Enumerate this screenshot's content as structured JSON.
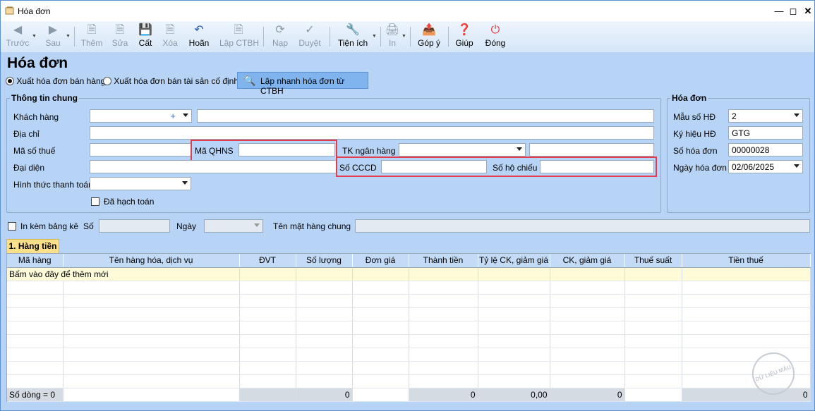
{
  "window": {
    "title": "Hóa đơn"
  },
  "toolbar": {
    "prev": "Trước",
    "next": "Sau",
    "add": "Thêm",
    "edit": "Sửa",
    "save": "Cất",
    "delete": "Xóa",
    "undo": "Hoãn",
    "create_ctbh": "Lập CTBH",
    "reload": "Nạp",
    "approve": "Duyệt",
    "utilities": "Tiện ích",
    "print": "In",
    "feedback": "Góp ý",
    "help": "Giúp",
    "close": "Đóng"
  },
  "page": {
    "title": "Hóa đơn",
    "radio_sales": "Xuất hóa đơn bán hàng",
    "radio_assets": "Xuất hóa đơn bán tài sản cố định",
    "quick_button": "Lập nhanh hóa đơn từ CTBH"
  },
  "general": {
    "title": "Thông tin chung",
    "customer_label": "Khách hàng",
    "address_label": "Địa chỉ",
    "tax_code_label": "Mã số thuế",
    "qhns_label": "Mã QHNS",
    "bank_label": "TK ngân hàng",
    "representative_label": "Đại diện",
    "cccd_label": "Số CCCD",
    "passport_label": "Số hộ chiếu",
    "payment_label": "Hình thức thanh toán",
    "posted_label": "Đã hạch toán"
  },
  "invoice": {
    "title": "Hóa đơn",
    "template_label": "Mẫu số HĐ",
    "template_value": "2",
    "symbol_label": "Ký hiệu HĐ",
    "symbol_value": "GTG",
    "number_label": "Số hóa đơn",
    "number_value": "00000028",
    "date_label": "Ngày hóa đơn",
    "date_value": "02/06/2025"
  },
  "attach": {
    "print_with_list": "In kèm bảng kê",
    "number_label": "Số",
    "date_label": "Ngày",
    "common_item_label": "Tên mặt hàng chung"
  },
  "tab": {
    "label": "1. Hàng tiền"
  },
  "grid": {
    "columns": [
      "Mã hàng",
      "Tên hàng hóa, dịch vụ",
      "ĐVT",
      "Số lượng",
      "Đơn giá",
      "Thành tiền",
      "Tỷ lệ CK, giảm giá",
      "CK, giảm giá",
      "Thuế suất",
      "Tiền thuế"
    ],
    "add_row": "Bấm vào đây để thêm mới",
    "footer": {
      "row_count": "Số dòng = 0",
      "quantity": "0",
      "amount": "0",
      "discount_rate": "0,00",
      "discount": "0",
      "tax": "0"
    }
  },
  "watermark": "DỮ LIỆU MẪU",
  "colors": {
    "main_bg": "#b7d3f5",
    "highlight": "#e13f4e",
    "tab": "#ffe08a"
  }
}
